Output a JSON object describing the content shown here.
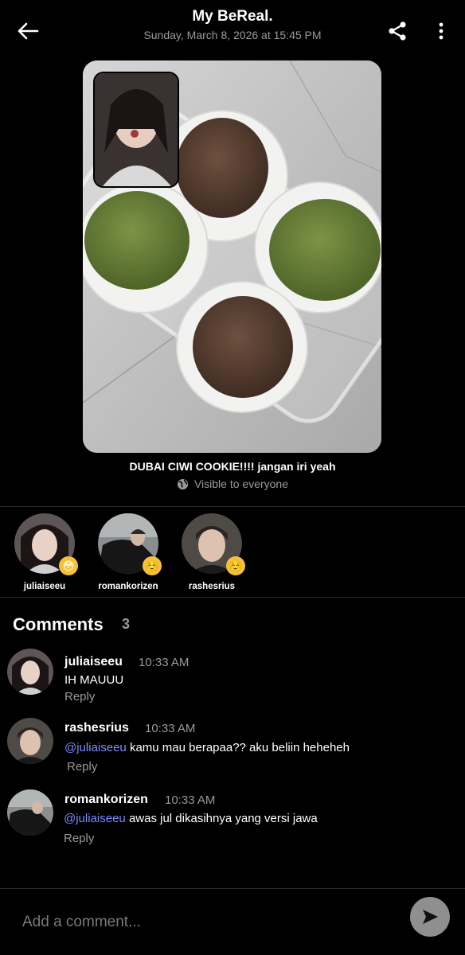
{
  "header": {
    "title": "My BeReal.",
    "subtitle": "Sunday, March 8, 2026 at 15:45 PM",
    "back_icon": "arrow-left-icon",
    "share_icon": "share-icon",
    "more_icon": "more-vertical-icon"
  },
  "post": {
    "caption": "DUBAI CIWI COOKIE!!!! jangan iri yeah",
    "visibility": "Visible to everyone",
    "visibility_icon": "globe-icon"
  },
  "reactions": [
    {
      "username": "juliaiseeu",
      "emoji": "😳"
    },
    {
      "username": "romankorizen",
      "emoji": "☺️"
    },
    {
      "username": "rashesrius",
      "emoji": "☺️"
    }
  ],
  "comments_section": {
    "title": "Comments",
    "count": "3"
  },
  "comments": [
    {
      "username": "juliaiseeu",
      "time": "10:33 AM",
      "mention": "",
      "text": "IH MAUUU",
      "reply": "Reply"
    },
    {
      "username": "rashesrius",
      "time": "10:33 AM",
      "mention": "@juliaiseeu",
      "text": " kamu mau berapaa?? aku beliin heheheh",
      "reply": "Reply"
    },
    {
      "username": "romankorizen",
      "time": "10:33 AM",
      "mention": "@juliaiseeu",
      "text": " awas jul dikasihnya yang versi jawa",
      "reply": "Reply"
    }
  ],
  "input": {
    "placeholder": "Add a comment...",
    "send_icon": "send-icon"
  },
  "colors": {
    "background": "#000000",
    "mention": "#7c8cff",
    "muted": "#9a9a9a",
    "send_button": "#8f8f8f"
  }
}
